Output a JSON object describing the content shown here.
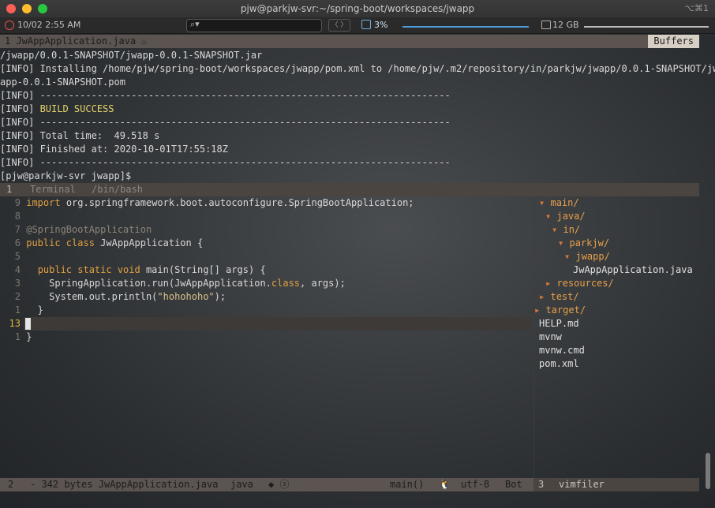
{
  "window": {
    "title": "pjw@parkjw-svr:~/spring-boot/workspaces/jwapp",
    "shortcut": "⌥⌘1"
  },
  "statusbar": {
    "time": "10/02 2:55 AM",
    "cpu": "3%",
    "cpu_fraction": 0.03,
    "mem": "12 GB",
    "nav": "〈 〉"
  },
  "tabline": {
    "tab": "1  JwAppApplication.java ♨",
    "buffers": "Buffers"
  },
  "terminal": {
    "lines": [
      "/jwapp/0.0.1-SNAPSHOT/jwapp-0.0.1-SNAPSHOT.jar",
      "[INFO] Installing /home/pjw/spring-boot/workspaces/jwapp/pom.xml to /home/pjw/.m2/repository/in/parkjw/jwapp/0.0.1-SNAPSHOT/jw",
      "app-0.0.1-SNAPSHOT.pom",
      "[INFO] ------------------------------------------------------------------------",
      "[INFO] ",
      "[INFO] ------------------------------------------------------------------------",
      "[INFO] Total time:  49.518 s",
      "[INFO] Finished at: 2020-10-01T17:55:18Z",
      "[INFO] ------------------------------------------------------------------------",
      "[pjw@parkjw-svr jwapp]$"
    ],
    "build_success": "BUILD SUCCESS",
    "status_num": "1",
    "status_name": "Terminal",
    "status_shell": "/bin/bash"
  },
  "editor": {
    "lines": [
      {
        "num": "9",
        "text": "import org.springframework.boot.autoconfigure.SpringBootApplication;"
      },
      {
        "num": "8",
        "text": ""
      },
      {
        "num": "7",
        "text": "@SpringBootApplication"
      },
      {
        "num": "6",
        "text": "public class JwAppApplication {"
      },
      {
        "num": "5",
        "text": ""
      },
      {
        "num": "4",
        "text": "  public static void main(String[] args) {"
      },
      {
        "num": "3",
        "text": "    SpringApplication.run(JwAppApplication.class, args);"
      },
      {
        "num": "2",
        "text": "    System.out.println(\"hohohoho\");"
      },
      {
        "num": "1",
        "text": "  }"
      },
      {
        "num": "13",
        "text": ""
      },
      {
        "num": "1",
        "text": "}"
      }
    ]
  },
  "filetree": [
    {
      "arrow": "▾",
      "name": "main/",
      "indent": 0,
      "type": "dir"
    },
    {
      "arrow": "▾",
      "name": "java/",
      "indent": 1,
      "type": "dir"
    },
    {
      "arrow": "▾",
      "name": "in/",
      "indent": 2,
      "type": "dir"
    },
    {
      "arrow": "▾",
      "name": "parkjw/",
      "indent": 3,
      "type": "dir"
    },
    {
      "arrow": "▾",
      "name": "jwapp/",
      "indent": 4,
      "type": "dir"
    },
    {
      "arrow": "",
      "name": "JwAppApplication.java",
      "indent": 5,
      "type": "file"
    },
    {
      "arrow": "▸",
      "name": "resources/",
      "indent": 1,
      "type": "dir"
    },
    {
      "arrow": "▸",
      "name": "test/",
      "indent": 0,
      "type": "dir"
    },
    {
      "arrow": "▸",
      "name": "target/",
      "indent": -1,
      "type": "dir"
    },
    {
      "arrow": "",
      "name": "HELP.md",
      "indent": -1,
      "type": "file"
    },
    {
      "arrow": "",
      "name": "mvnw",
      "indent": -1,
      "type": "file"
    },
    {
      "arrow": "",
      "name": "mvnw.cmd",
      "indent": -1,
      "type": "file"
    },
    {
      "arrow": "",
      "name": "pom.xml",
      "indent": -1,
      "type": "file"
    }
  ],
  "bottombar": {
    "num": "2",
    "fileinfo": "- 342 bytes JwAppApplication.java",
    "filetype": "java",
    "symbols": "◆ ⓢ",
    "branch": "main()",
    "os": "🐧",
    "encoding": "utf-8",
    "position": "Bot"
  },
  "bottom2": {
    "num": "3",
    "name": "vimfiler"
  }
}
